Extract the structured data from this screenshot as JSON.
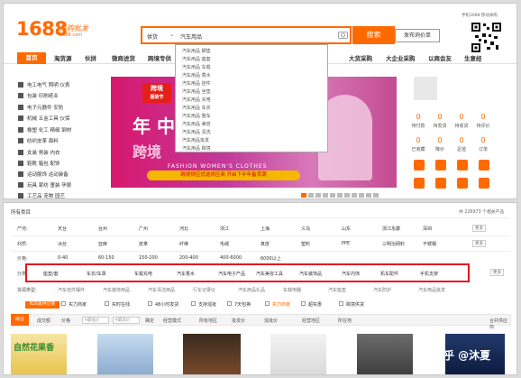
{
  "logo": {
    "number": "1688",
    "cn": "采购批发",
    "url": "1688.com"
  },
  "search": {
    "category": "供货",
    "value": "汽车用品",
    "button": "搜索",
    "publish": "发布询价单"
  },
  "qr": {
    "title": "手机1688 移动采购"
  },
  "nav": {
    "home": "首页",
    "items": [
      "淘货源",
      "伙拼",
      "微商进货",
      "跨境专供",
      "",
      "",
      "",
      "",
      "",
      "大货采购",
      "大企业采购",
      "以商会友",
      "生意经"
    ]
  },
  "categories": [
    "电工电气 照明 仪表",
    "包装 印刷纸业",
    "电子元器件 安防",
    "机械 五金工具 仪保",
    "橡塑 化工 精细 钢材",
    "纺织皮革 面料",
    "女装 男装 内衣",
    "鞋靴 箱包 配饰",
    "运动服饰 运动装备",
    "玩具 家纺 童装 孕婴",
    "工艺品 宠物 园艺"
  ],
  "dropdown": [
    "汽车用品 脚垫",
    "汽车用品 座套",
    "汽车用品 车载",
    "汽车用品 香水",
    "汽车用品 挂件",
    "汽车用品 坐垫",
    "汽车用品 充电",
    "汽车用品 车衣",
    "汽车用品 整车",
    "汽车用品 美容",
    "汽车用品 清洗",
    "汽车用品批发",
    "汽车用品 跨境"
  ],
  "banner": {
    "tag_line1": "跨境",
    "tag_line2": "服装节",
    "big1": "年 中",
    "big2": "跨境",
    "fashion": "FASHION WOMEN'S CLOTHES",
    "cta": "跨境供应优选供应商 开启下半年备货潮"
  },
  "user_stats": [
    {
      "num": "0",
      "label": "待付款"
    },
    {
      "num": "0",
      "label": "待发货"
    },
    {
      "num": "0",
      "label": "待收货"
    },
    {
      "num": "0",
      "label": "待评价"
    },
    {
      "num": "0",
      "label": "已收藏"
    },
    {
      "num": "0",
      "label": "降价"
    },
    {
      "num": "0",
      "label": "足迹"
    },
    {
      "num": "0",
      "label": "订单"
    }
  ],
  "bottom": {
    "allcat": "所有类目",
    "total": "共 226973 个相关产品",
    "rows": [
      {
        "label": "产地:",
        "cells": [
          "天台",
          "台州",
          "广州",
          "河北",
          "浙江",
          "上海",
          "义乌",
          "山东",
          "浙江永康",
          "深圳"
        ],
        "more": "更多"
      },
      {
        "label": "材质:",
        "cells": [
          "冰丝",
          "亚麻",
          "皮革",
          "纤维",
          "毛绒",
          "真皮",
          "塑料",
          "PPE",
          "三明治网料",
          "不锈钢"
        ],
        "more": "更多"
      },
      {
        "label": "价格:",
        "cells": [
          "0-40",
          "60-150",
          "150-200",
          "200-400",
          "400-6000",
          "6000以上"
        ],
        "more": ""
      },
      {
        "label": "分类:",
        "cells": [
          "座垫/套",
          "车衣/车罩",
          "车载充电",
          "汽车香水",
          "汽车电子产品",
          "汽车美容工具",
          "汽车装饰品",
          "汽车内饰",
          "机车配件",
          "手机支架"
        ],
        "more": "更多"
      }
    ],
    "row5_label": "货源类型:",
    "row5_cells": [
      "汽车挂件摆件",
      "汽车装饰用品",
      "汽车清洁用品",
      "行车记录仪",
      "汽车用品礼品",
      "车载电器",
      "汽车座垫",
      "汽车防护",
      "汽车用品批发"
    ],
    "badge": "826家供应商",
    "filters": [
      "实力商家",
      "实时在线",
      "48小时发货",
      "支持混批",
      "7天包换",
      "实力商家",
      "超实惠",
      "跨境供货"
    ],
    "sort": [
      "综合",
      "成交额",
      "价格",
      "¥最低价",
      "¥最高价",
      "确定",
      "经营模式",
      "所有地区",
      "批发价",
      "混批价",
      "经营地区",
      "所在地"
    ],
    "sort_right": "合并供应商",
    "product_tags": [
      "自然花果香"
    ],
    "watermark": "知乎 @沐夏"
  },
  "colors": {
    "accent": "#ff6a00",
    "highlight_box": "#e4161f"
  }
}
